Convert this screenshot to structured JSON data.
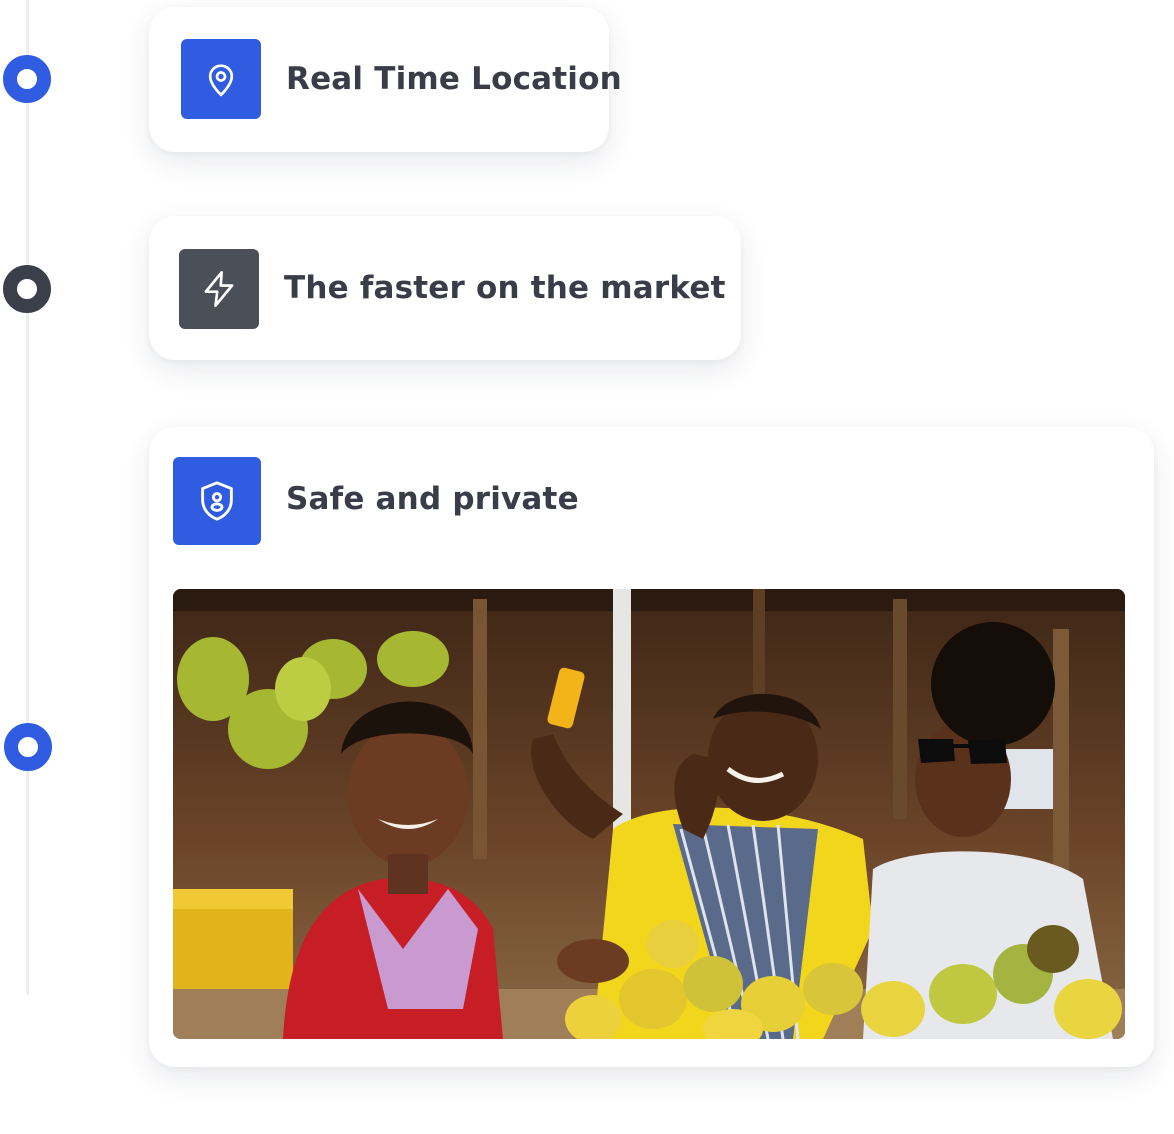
{
  "timeline": {
    "steps": [
      {
        "title": "Real Time Location",
        "icon": "location-pin-icon",
        "accent": "#2f5ce0",
        "active": true
      },
      {
        "title": "The faster on the market",
        "icon": "lightning-icon",
        "accent": "#4b4f58",
        "active": false
      },
      {
        "title": "Safe and private",
        "icon": "shield-user-icon",
        "accent": "#2f5ce0",
        "active": true
      }
    ]
  },
  "colors": {
    "primary": "#2f5ce0",
    "dark": "#3b3f49",
    "text": "#3a3d47"
  },
  "photo": {
    "subject": "market-stall-photo"
  }
}
